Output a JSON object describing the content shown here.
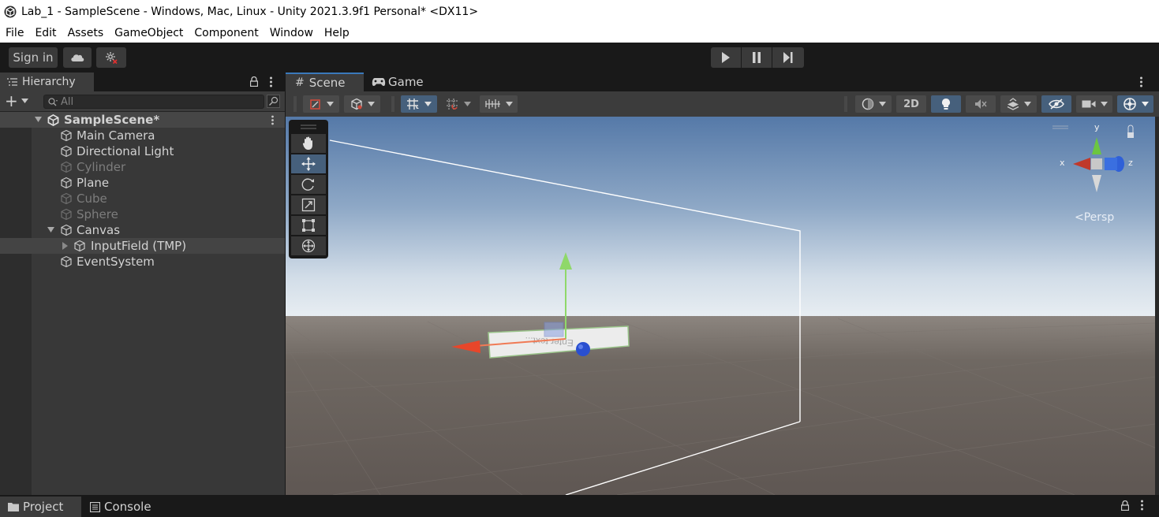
{
  "window": {
    "title": "Lab_1 - SampleScene - Windows, Mac, Linux - Unity 2021.3.9f1 Personal* <DX11>"
  },
  "menu": [
    "File",
    "Edit",
    "Assets",
    "GameObject",
    "Component",
    "Window",
    "Help"
  ],
  "toolbar": {
    "sign_in": "Sign in"
  },
  "hierarchy": {
    "tab_label": "Hierarchy",
    "add_label": "+",
    "search_placeholder": "All",
    "scene_name": "SampleScene*",
    "items": [
      {
        "label": "Main Camera",
        "active": true
      },
      {
        "label": "Directional Light",
        "active": true
      },
      {
        "label": "Cylinder",
        "active": false
      },
      {
        "label": "Plane",
        "active": true
      },
      {
        "label": "Cube",
        "active": false
      },
      {
        "label": "Sphere",
        "active": false
      },
      {
        "label": "Canvas",
        "active": true
      },
      {
        "label": "InputField (TMP)",
        "active": true
      },
      {
        "label": "EventSystem",
        "active": true
      }
    ]
  },
  "scene_view": {
    "tabs": [
      "Scene",
      "Game"
    ],
    "btn_2d": "2D",
    "gizmo": {
      "x_label": "x",
      "y_label": "y",
      "z_label": "z",
      "projection": "Persp"
    },
    "input_field_text": "Enter text..."
  },
  "bottom_tabs": [
    "Project",
    "Console"
  ]
}
